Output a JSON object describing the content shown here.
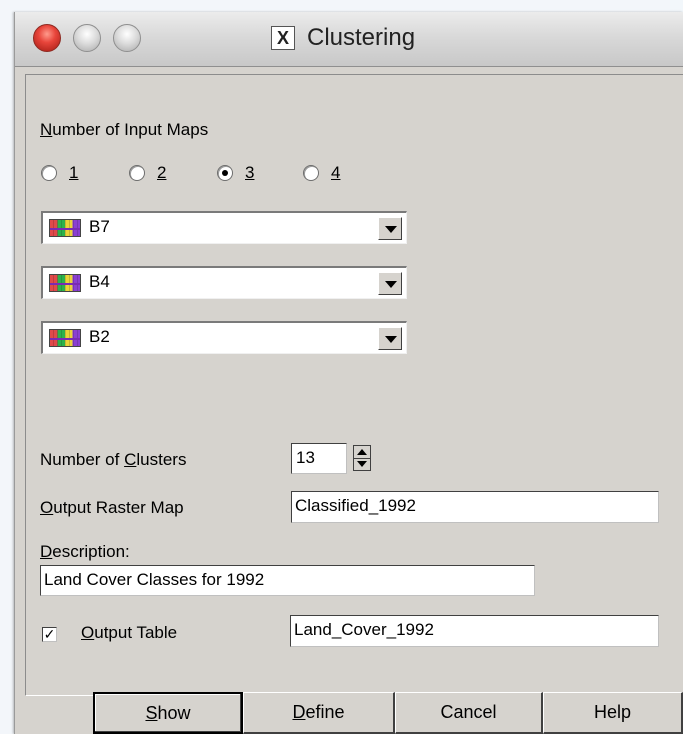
{
  "window": {
    "title": "Clustering",
    "app_icon_glyph": "X"
  },
  "input_maps": {
    "label_prefix": "N",
    "label_rest": "umber of Input Maps",
    "options": [
      {
        "key": "1",
        "selected": false
      },
      {
        "key": "2",
        "selected": false
      },
      {
        "key": "3",
        "selected": true
      },
      {
        "key": "4",
        "selected": false
      }
    ],
    "maps": [
      "B7",
      "B4",
      "B2"
    ]
  },
  "clusters": {
    "label_a": "Number of ",
    "label_u": "C",
    "label_b": "lusters",
    "value": "13"
  },
  "output_raster": {
    "label_u": "O",
    "label_rest": "utput Raster Map",
    "value": "Classified_1992"
  },
  "description": {
    "label_u": "D",
    "label_rest": "escription:",
    "value": "Land Cover Classes for 1992"
  },
  "output_table": {
    "checked": true,
    "check_glyph": "✓",
    "label_u": "O",
    "label_rest": "utput Table",
    "value": "Land_Cover_1992"
  },
  "buttons": {
    "show_u": "S",
    "show_rest": "how",
    "define_u": "D",
    "define_rest": "efine",
    "cancel": "Cancel",
    "help": "Help"
  },
  "colors": {
    "dialog_bg": "#d6d3ce",
    "close_red": "#e8453b"
  }
}
